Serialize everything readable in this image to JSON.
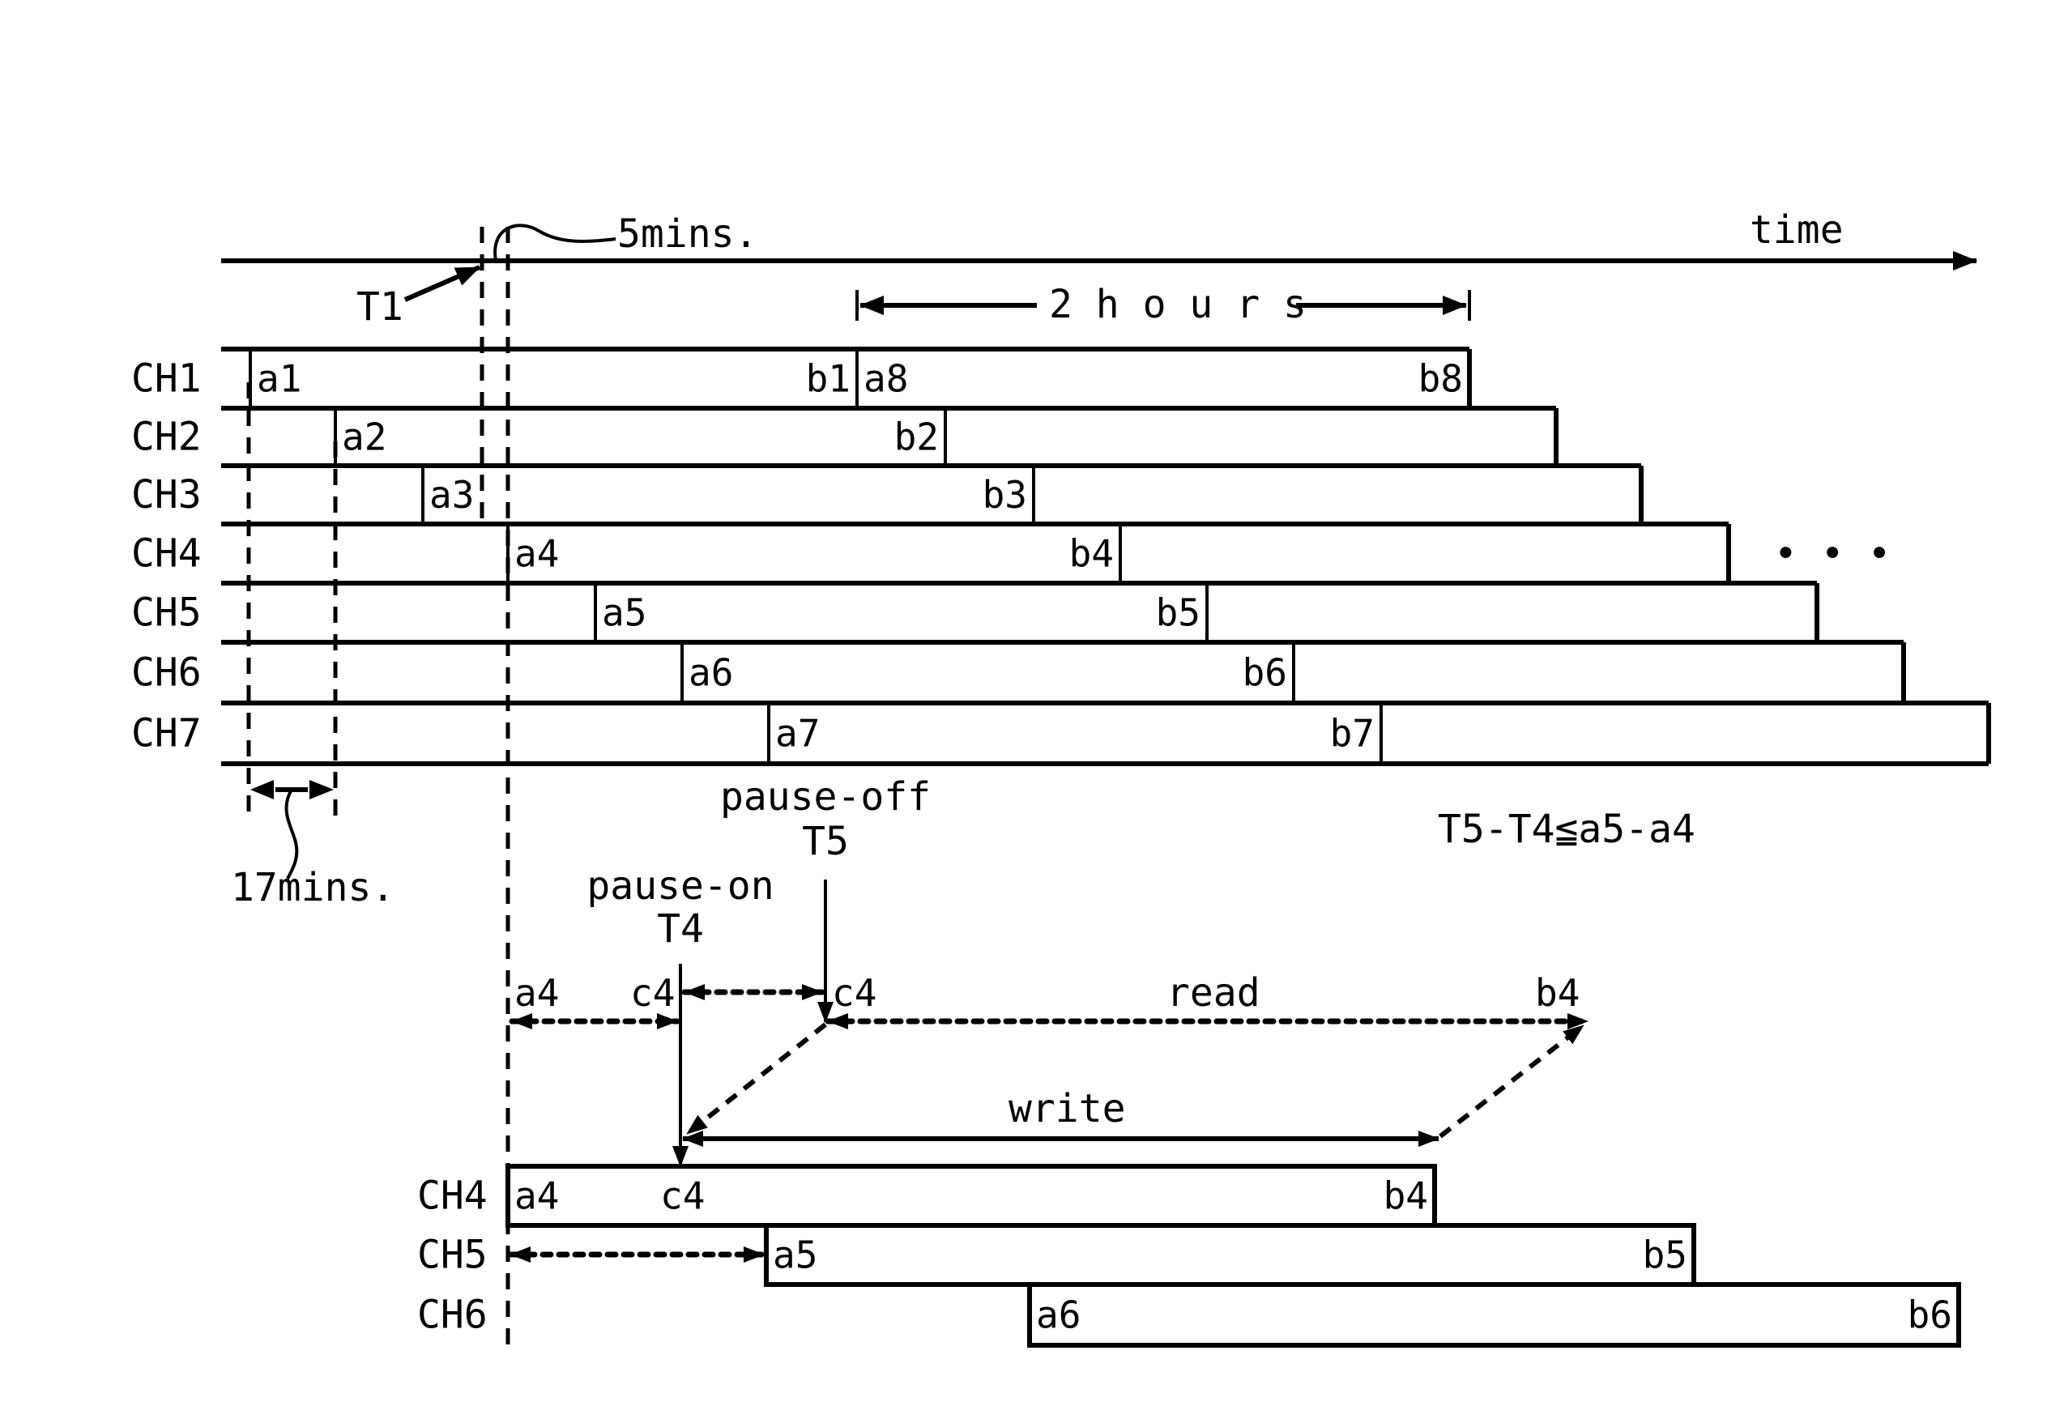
{
  "axis": {
    "time_label": "time",
    "t1_label": "T1",
    "gap_label": "5mins.",
    "span_label": "2 h o u r s"
  },
  "channels_top": [
    {
      "name": "CH1",
      "start": "a1",
      "end": "b1",
      "next_start": "a8",
      "next_end": "b8"
    },
    {
      "name": "CH2",
      "start": "a2",
      "end": "b2"
    },
    {
      "name": "CH3",
      "start": "a3",
      "end": "b3"
    },
    {
      "name": "CH4",
      "start": "a4",
      "end": "b4"
    },
    {
      "name": "CH5",
      "start": "a5",
      "end": "b5"
    },
    {
      "name": "CH6",
      "start": "a6",
      "end": "b6"
    },
    {
      "name": "CH7",
      "start": "a7",
      "end": "b7"
    }
  ],
  "ellipsis": "•  •  •",
  "interval_label": "17mins.",
  "formula": "T5-T4≦a5-a4",
  "pause_off": {
    "label": "pause-off",
    "time": "T5"
  },
  "pause_on": {
    "label": "pause-on",
    "time": "T4"
  },
  "detail": {
    "a4": "a4",
    "c4_left": "c4",
    "c4_right": "c4",
    "read_label": "read",
    "b4": "b4",
    "write_label": "write"
  },
  "channels_bottom": [
    {
      "name": "CH4",
      "start": "a4",
      "mid": "c4",
      "end": "b4"
    },
    {
      "name": "CH5",
      "start": "a5",
      "end": "b5"
    },
    {
      "name": "CH6",
      "start": "a6",
      "end": "b6"
    }
  ]
}
